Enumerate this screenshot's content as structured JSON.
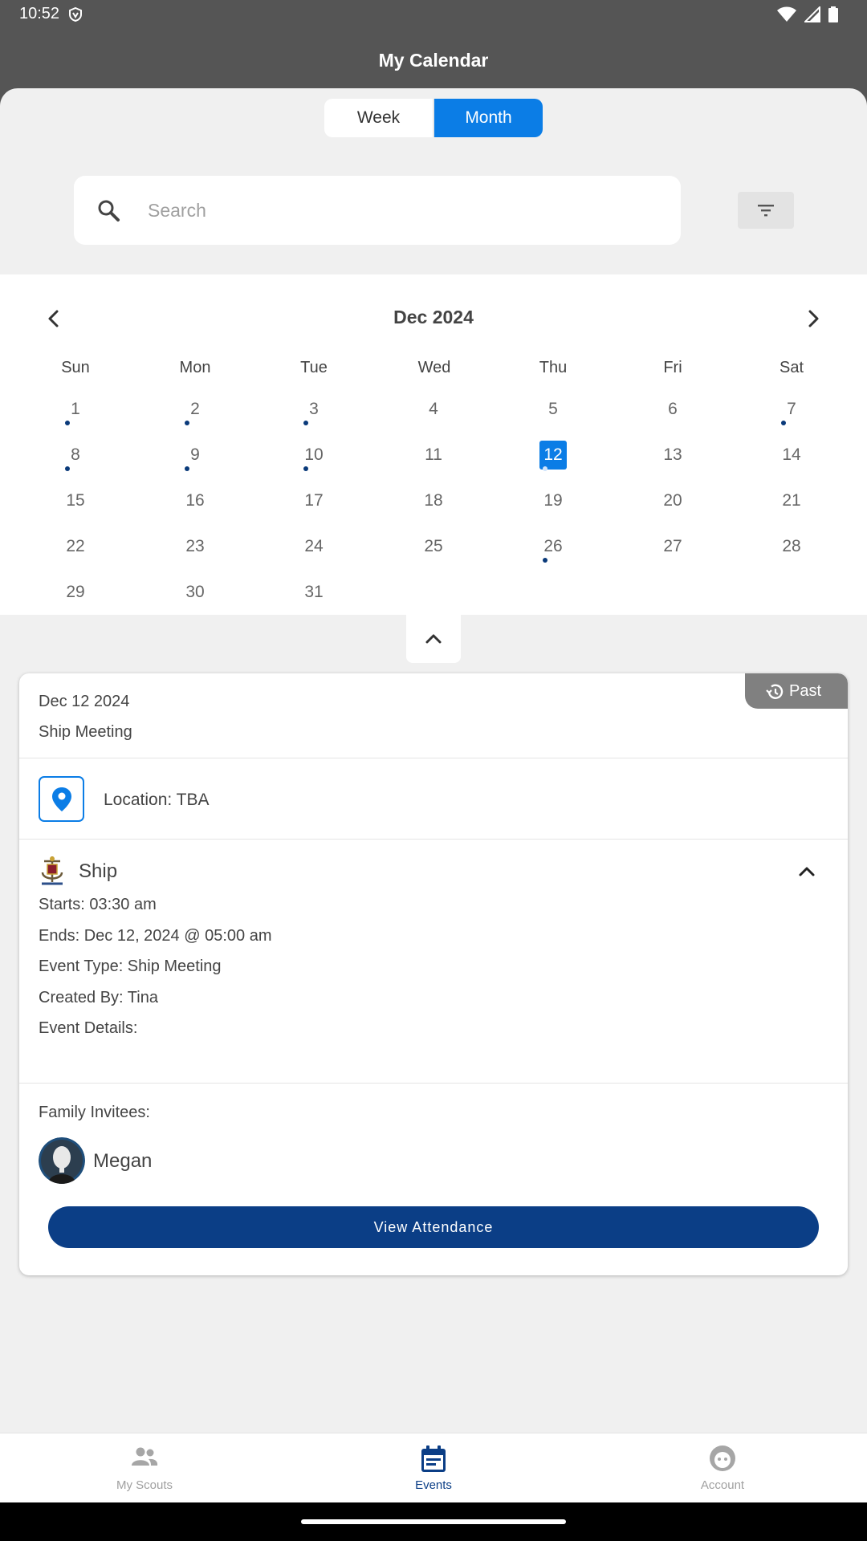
{
  "status_bar": {
    "time": "10:52"
  },
  "app_bar": {
    "title": "My Calendar"
  },
  "view_toggle": {
    "week": "Week",
    "month": "Month",
    "selected": "Month"
  },
  "search": {
    "placeholder": "Search",
    "value": ""
  },
  "calendar": {
    "month_label": "Dec 2024",
    "weekdays": [
      "Sun",
      "Mon",
      "Tue",
      "Wed",
      "Thu",
      "Fri",
      "Sat"
    ],
    "weeks": [
      [
        "1",
        "2",
        "3",
        "4",
        "5",
        "6",
        "7"
      ],
      [
        "8",
        "9",
        "10",
        "11",
        "12",
        "13",
        "14"
      ],
      [
        "15",
        "16",
        "17",
        "18",
        "19",
        "20",
        "21"
      ],
      [
        "22",
        "23",
        "24",
        "25",
        "26",
        "27",
        "28"
      ],
      [
        "29",
        "30",
        "31",
        "",
        "",
        "",
        ""
      ]
    ],
    "days_with_events": [
      "1",
      "2",
      "3",
      "7",
      "8",
      "9",
      "10",
      "12",
      "26"
    ],
    "selected_day": "12"
  },
  "event": {
    "badge": "Past",
    "date": "Dec 12 2024",
    "name": "Ship Meeting",
    "location": "Location: TBA",
    "unit": "Ship",
    "starts": "Starts: 03:30 am",
    "ends": "Ends: Dec 12, 2024 @ 05:00 am",
    "event_type": "Event Type: Ship Meeting",
    "created_by": "Created By: Tina",
    "details_label": "Event Details:",
    "invitees_label": "Family Invitees:",
    "invitee_name": "Megan",
    "attendance_button": "View Attendance"
  },
  "bottom_nav": {
    "items": [
      {
        "label": "My Scouts",
        "icon": "people-icon"
      },
      {
        "label": "Events",
        "icon": "calendar-icon"
      },
      {
        "label": "Account",
        "icon": "account-face-icon"
      }
    ],
    "active": "Events"
  },
  "colors": {
    "accent": "#0b7de6",
    "primary_dark": "#0b3e86",
    "header": "#555555",
    "background": "#f0f0f0",
    "event_dot": "#0a3a7a"
  }
}
